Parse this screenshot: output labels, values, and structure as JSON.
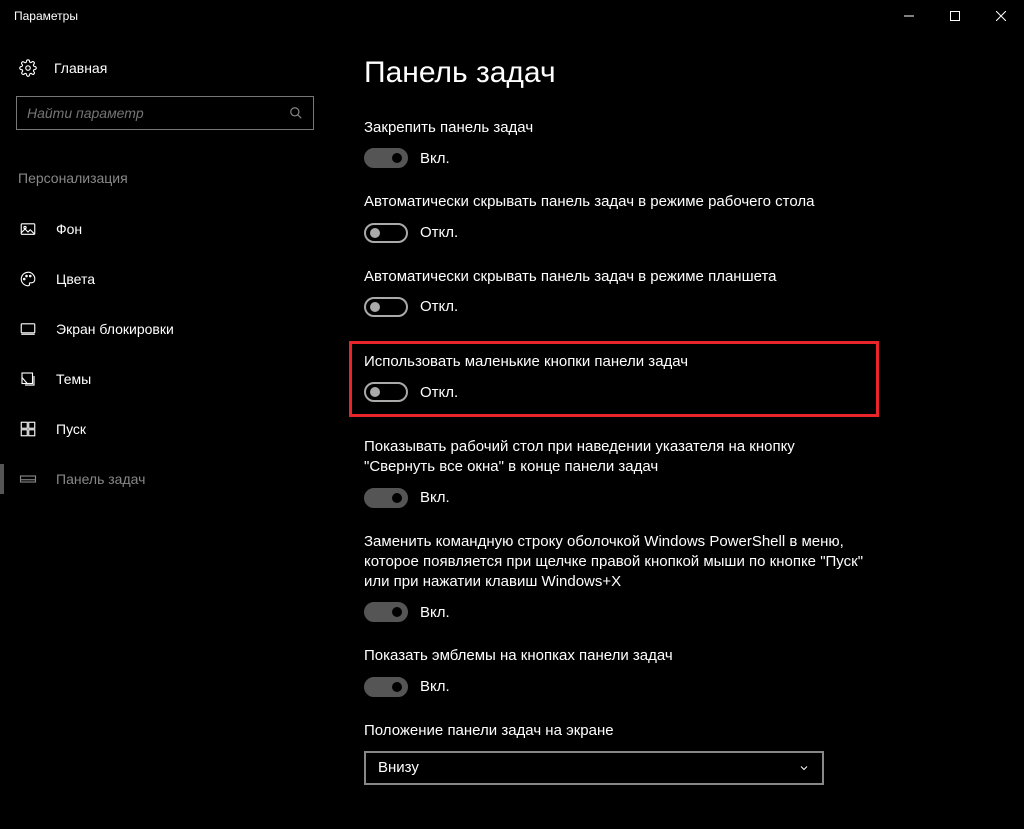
{
  "window_title": "Параметры",
  "sidebar": {
    "home_label": "Главная",
    "search_placeholder": "Найти параметр",
    "category": "Персонализация",
    "items": [
      {
        "label": "Фон"
      },
      {
        "label": "Цвета"
      },
      {
        "label": "Экран блокировки"
      },
      {
        "label": "Темы"
      },
      {
        "label": "Пуск"
      },
      {
        "label": "Панель задач"
      }
    ]
  },
  "page": {
    "title": "Панель задач",
    "settings": [
      {
        "label": "Закрепить панель задач",
        "state": "Вкл.",
        "on": true
      },
      {
        "label": "Автоматически скрывать панель задач в режиме рабочего стола",
        "state": "Откл.",
        "on": false
      },
      {
        "label": "Автоматически скрывать панель задач в режиме планшета",
        "state": "Откл.",
        "on": false
      },
      {
        "label": "Использовать маленькие кнопки панели задач",
        "state": "Откл.",
        "on": false,
        "highlighted": true
      },
      {
        "label": "Показывать рабочий стол при наведении указателя на кнопку \"Свернуть все окна\" в конце панели задач",
        "state": "Вкл.",
        "on": true
      },
      {
        "label": "Заменить командную строку оболочкой Windows PowerShell в меню, которое появляется при щелчке правой кнопкой мыши по кнопке \"Пуск\" или при нажатии клавиш Windows+X",
        "state": "Вкл.",
        "on": true
      },
      {
        "label": "Показать эмблемы на кнопках панели задач",
        "state": "Вкл.",
        "on": true
      }
    ],
    "position": {
      "label": "Положение панели задач на экране",
      "value": "Внизу"
    }
  }
}
